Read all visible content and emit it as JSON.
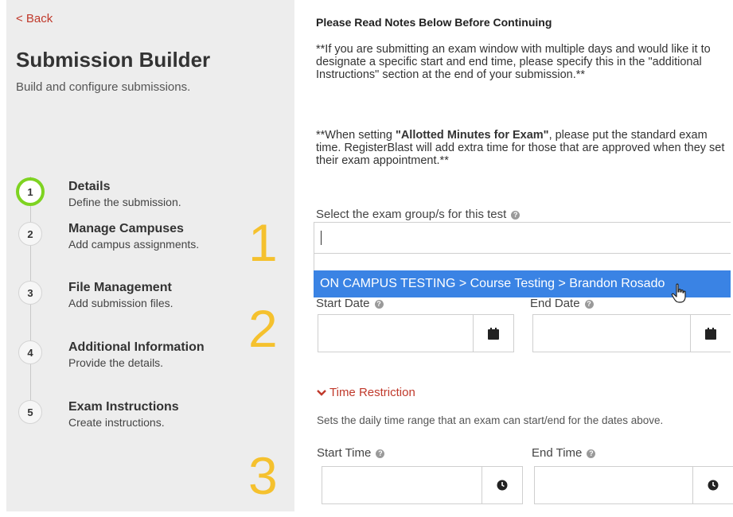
{
  "sidebar": {
    "back_label": "< Back",
    "title": "Submission Builder",
    "subtitle": "Build and configure submissions.",
    "steps": [
      {
        "num": "1",
        "title": "Details",
        "desc": "Define the submission."
      },
      {
        "num": "2",
        "title": "Manage Campuses",
        "desc": "Add campus assignments."
      },
      {
        "num": "3",
        "title": "File Management",
        "desc": "Add submission files."
      },
      {
        "num": "4",
        "title": "Additional Information",
        "desc": "Provide the details."
      },
      {
        "num": "5",
        "title": "Exam Instructions",
        "desc": "Create instructions."
      }
    ]
  },
  "annotations": [
    "1",
    "2",
    "3"
  ],
  "notes": {
    "heading": "Please Read Notes Below Before Continuing",
    "para1": "**If you are submitting an exam window with multiple days and would like it to designate a specific start and end time, please specify this in the \"additional Instructions\" section at the end of your submission.**",
    "para2_pre": "**When setting ",
    "para2_bold": "\"Allotted Minutes for Exam\"",
    "para2_post": ", please put the standard exam time. RegisterBlast will add  extra time for those that are approved when they set their exam appointment.**"
  },
  "form": {
    "exam_group_label": "Select the exam group/s for this test",
    "exam_group_value": "",
    "dropdown_option": "ON CAMPUS TESTING > Course Testing > Brandon Rosado",
    "start_date_label": "Start Date",
    "end_date_label": "End Date",
    "start_date_value": "",
    "end_date_value": "",
    "time_restriction_toggle": "Time Restriction",
    "time_restriction_desc": "Sets the daily time range that an exam can start/end for the dates above.",
    "start_time_label": "Start Time",
    "end_time_label": "End Time",
    "start_time_value": "",
    "end_time_value": ""
  },
  "icons": {
    "help": "question-circle-icon",
    "calendar": "calendar-icon",
    "clock": "clock-icon",
    "chevron": "chevron-down-icon",
    "help_glyph": "?"
  },
  "colors": {
    "accent_red": "#c0392b",
    "active_step": "#7ed321",
    "dropdown_highlight": "#3a83e4",
    "annotation_yellow": "#f5c12e"
  }
}
